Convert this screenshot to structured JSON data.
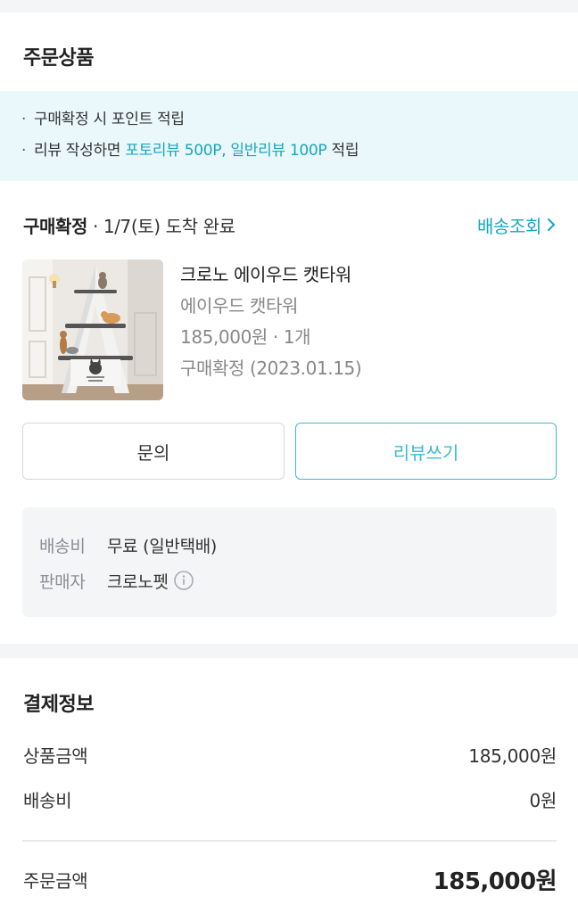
{
  "order_section": {
    "title": "주문상품",
    "notices": {
      "line1": {
        "bullet": "·",
        "text": "구매확정 시 포인트 적립"
      },
      "line2": {
        "bullet": "·",
        "prefix": "리뷰 작성하면 ",
        "highlight": "포토리뷰 500P, 일반리뷰 100P",
        "suffix": " 적립"
      }
    },
    "status": {
      "label": "구매확정",
      "detail": " · 1/7(토) 도착 완료",
      "tracking_link": "배송조회",
      "chevron_icon": "chevron-right-icon"
    },
    "product": {
      "image_alt": "cat-tower-product-image",
      "name": "크로노 에이우드 캣타워",
      "option": "에이우드 캣타워",
      "price_qty": "185,000원 · 1개",
      "confirm_text": "구매확정 (2023.01.15)"
    },
    "buttons": {
      "inquiry": "문의",
      "review": "리뷰쓰기"
    },
    "shipping_info": {
      "fee_label": "배송비",
      "fee_value": "무료 (일반택배)",
      "seller_label": "판매자",
      "seller_value": "크로노펫",
      "info_icon": "info-icon"
    }
  },
  "payment_section": {
    "title": "결제정보",
    "rows": {
      "product_amount": {
        "label": "상품금액",
        "value": "185,000원"
      },
      "shipping_fee": {
        "label": "배송비",
        "value": "0원"
      },
      "order_total": {
        "label": "주문금액",
        "value": "185,000원"
      }
    }
  },
  "colors": {
    "accent": "#17a6c2",
    "review_button": "#3cbad3",
    "notice_bg": "#ebf8fb",
    "page_bg": "#f4f5f7"
  }
}
